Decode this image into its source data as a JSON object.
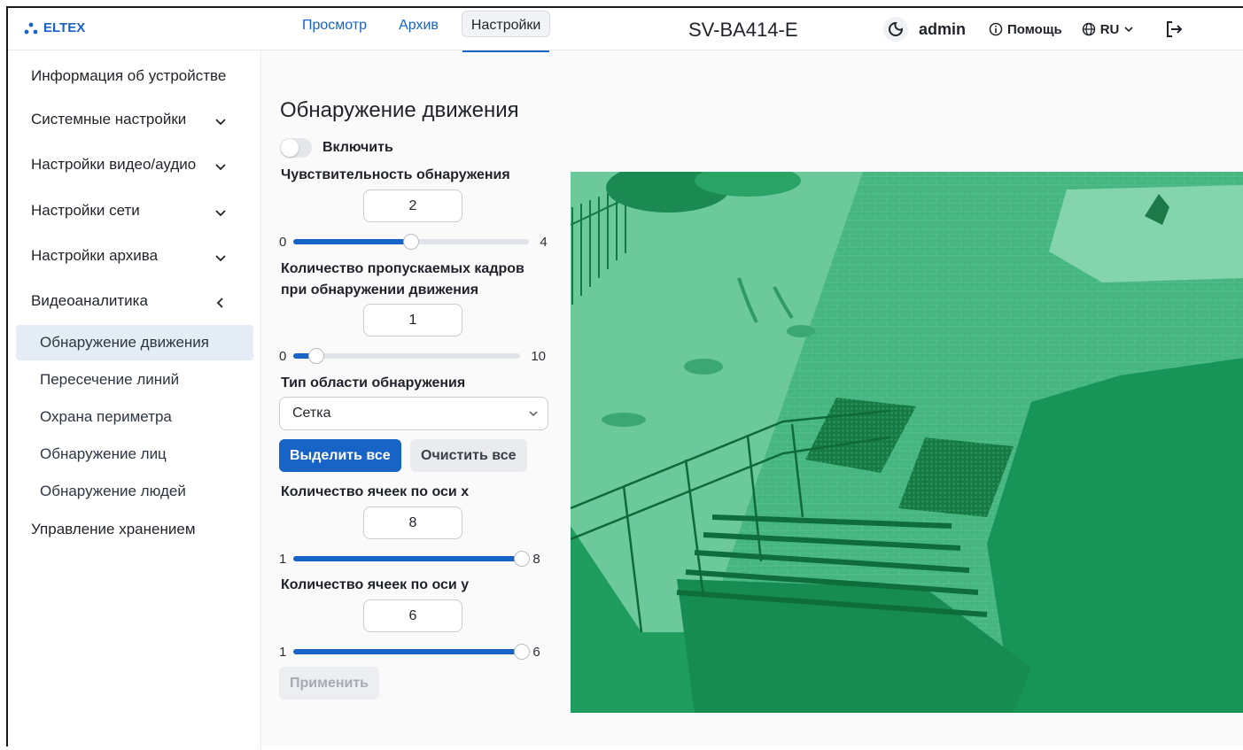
{
  "app": {
    "logo_text": "ELTEX",
    "device_name": "SV-BA414-E"
  },
  "nav": {
    "tabs": [
      {
        "label": "Просмотр"
      },
      {
        "label": "Архив"
      },
      {
        "label": "Настройки",
        "active": true
      }
    ]
  },
  "header": {
    "user": "admin",
    "help_label": "Помощь",
    "language": "RU"
  },
  "sidebar": {
    "items": [
      {
        "label": "Информация об устройстве"
      },
      {
        "label": "Системные настройки",
        "chevron": "down"
      },
      {
        "label": "Настройки видео/аудио",
        "chevron": "down"
      },
      {
        "label": "Настройки сети",
        "chevron": "down"
      },
      {
        "label": "Настройки архива",
        "chevron": "down"
      },
      {
        "label": "Видеоаналитика",
        "chevron": "left"
      }
    ],
    "subitems": [
      {
        "label": "Обнаружение движения",
        "active": true
      },
      {
        "label": "Пересечение линий"
      },
      {
        "label": "Охрана периметра"
      },
      {
        "label": "Обнаружение лиц"
      },
      {
        "label": "Обнаружение людей"
      }
    ],
    "last_item": {
      "label": "Управление хранением"
    }
  },
  "main": {
    "title": "Обнаружение движения",
    "enable_label": "Включить",
    "enabled": false,
    "sensitivity": {
      "label": "Чувствительность обнаружения",
      "value": "2",
      "min": "0",
      "max": "4"
    },
    "skip_frames": {
      "label_line1": "Количество пропускаемых кадров",
      "label_line2": "при обнаружении движения",
      "value": "1",
      "min": "0",
      "max": "10"
    },
    "area_type": {
      "label": "Тип области обнаружения",
      "selected": "Сетка"
    },
    "select_all_label": "Выделить все",
    "clear_all_label": "Очистить все",
    "cells_x": {
      "label": "Количество ячеек по оси x",
      "value": "8",
      "min": "1",
      "max": "8"
    },
    "cells_y": {
      "label": "Количество ячеек по оси y",
      "value": "6",
      "min": "1",
      "max": "6"
    },
    "apply_label": "Применить"
  },
  "colors": {
    "accent": "#1763c6",
    "overlay": "#1a9e63",
    "active_bg": "#e4ecf5"
  }
}
